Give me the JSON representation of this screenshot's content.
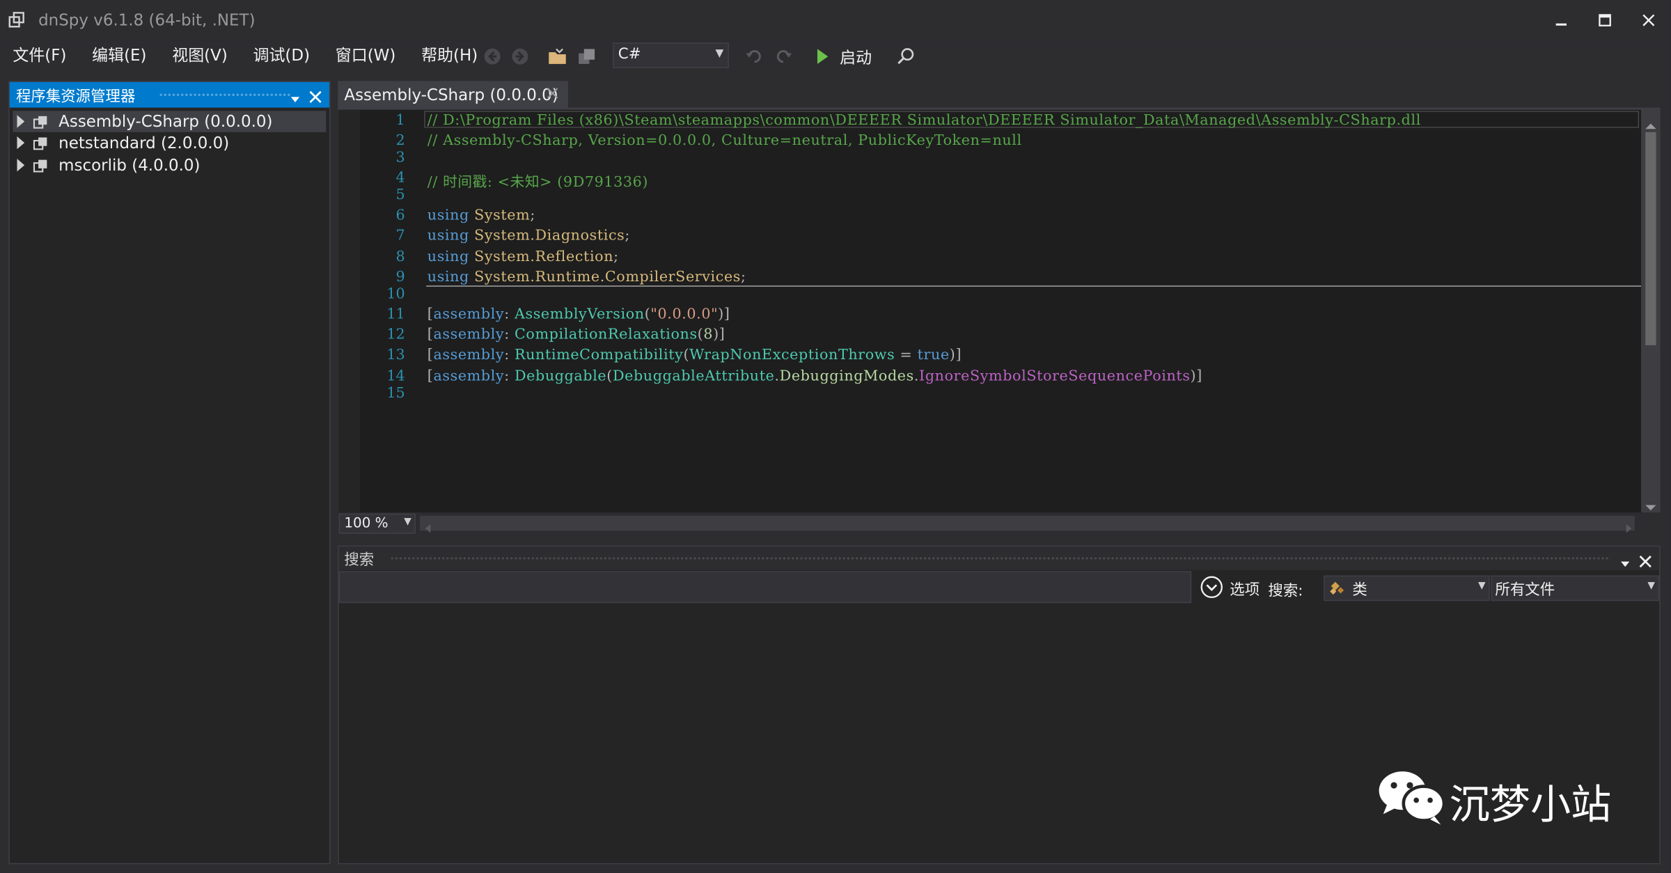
{
  "window": {
    "title": "dnSpy v6.1.8 (64-bit, .NET)"
  },
  "menu": {
    "items": [
      "文件(F)",
      "编辑(E)",
      "视图(V)",
      "调试(D)",
      "窗口(W)",
      "帮助(H)"
    ]
  },
  "toolbar": {
    "language": "C#",
    "run_label": "启动"
  },
  "assembly_explorer": {
    "title": "程序集资源管理器",
    "items": [
      {
        "label": "Assembly-CSharp (0.0.0.0)",
        "selected": true
      },
      {
        "label": "netstandard (2.0.0.0)",
        "selected": false
      },
      {
        "label": "mscorlib (4.0.0.0)",
        "selected": false
      }
    ]
  },
  "editor": {
    "tab_title": "Assembly-CSharp (0.0.0.0)",
    "zoom": "100 %",
    "line_numbers": [
      "1",
      "2",
      "3",
      "4",
      "5",
      "6",
      "7",
      "8",
      "9",
      "10",
      "11",
      "12",
      "13",
      "14",
      "15"
    ],
    "code": {
      "l1": "// D:\\Program Files (x86)\\Steam\\steamapps\\common\\DEEEER Simulator\\DEEEER Simulator_Data\\Managed\\Assembly-CSharp.dll",
      "l2": "// Assembly-CSharp, Version=0.0.0.0, Culture=neutral, PublicKeyToken=null",
      "l4": "// 时间戳: <未知> (9D791336)",
      "using": "using",
      "ns6": "System",
      "ns7": "System.Diagnostics",
      "ns8": "System.Reflection",
      "ns9": "System.Runtime.CompilerServices",
      "assembly_kw": "assembly",
      "a11_type": "AssemblyVersion",
      "a11_str": "\"0.0.0.0\"",
      "a12_type": "CompilationRelaxations",
      "a12_num": "8",
      "a13_type": "RuntimeCompatibility",
      "a13_prop": "WrapNonExceptionThrows",
      "a13_val": "true",
      "a14_type": "Debuggable",
      "a14_enum1": "DebuggableAttribute",
      "a14_enum2": "DebuggingModes",
      "a14_const": "IgnoreSymbolStoreSequencePoints"
    }
  },
  "search_panel": {
    "title": "搜索",
    "options_label": "选项",
    "search_label": "搜索:",
    "kind_value": "类",
    "scope_value": "所有文件",
    "query": ""
  },
  "watermark": {
    "text": "沉梦小站"
  }
}
